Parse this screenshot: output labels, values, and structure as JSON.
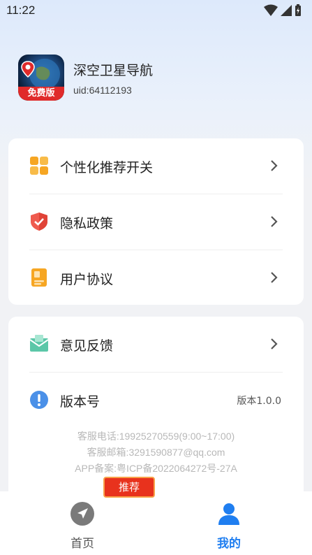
{
  "status": {
    "time": "11:22"
  },
  "profile": {
    "app_name": "深空卫星导航",
    "uid": "uid:64112193",
    "icon_badge": "免费版",
    "icon": "satellite-globe-map-pin-icon"
  },
  "menu_group_1": [
    {
      "label": "个性化推荐开关",
      "icon": "grid-icon"
    },
    {
      "label": "隐私政策",
      "icon": "shield-icon"
    },
    {
      "label": "用户协议",
      "icon": "document-icon"
    }
  ],
  "menu_group_2": {
    "feedback": {
      "label": "意见反馈",
      "icon": "mail-icon"
    },
    "version": {
      "label": "版本号",
      "value": "版本1.0.0",
      "icon": "info-icon"
    }
  },
  "footer": {
    "phone": "客服电话:19925270559(9:00~17:00)",
    "email": "客服邮箱:3291590877@qq.com",
    "icp": "APP备案:粤ICP备2022064272号-27A"
  },
  "recommend_button": "推荐",
  "tabs": [
    {
      "label": "首页",
      "icon": "navigation-arrow-icon",
      "active": false
    },
    {
      "label": "我的",
      "icon": "user-icon",
      "active": true
    }
  ],
  "colors": {
    "accent": "#1f7ef0",
    "recommend": "#e8321d",
    "background": "#f1f2f5"
  }
}
